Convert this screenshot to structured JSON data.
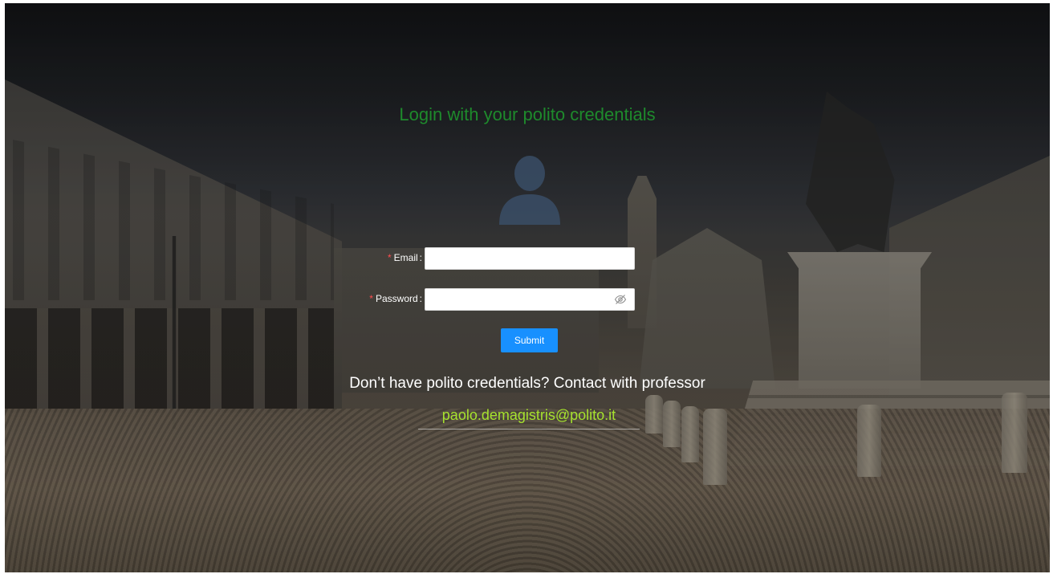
{
  "login": {
    "title": "Login with your polito credentials",
    "email_label": "Email",
    "password_label": "Password",
    "required_mark": "*",
    "colon": ":",
    "email_value": "",
    "password_value": "",
    "submit_label": "Submit",
    "contact_text": "Don’t have polito credentials? Contact with professor",
    "professor_email": "paolo.demagistris@polito.it"
  },
  "icons": {
    "avatar": "user-avatar-icon",
    "password_visibility": "eye-invisible-icon"
  },
  "colors": {
    "title": "#1e8a2c",
    "submit_bg": "#1890ff",
    "required": "#ff4d4f",
    "professor_email": "#a6e22e"
  }
}
